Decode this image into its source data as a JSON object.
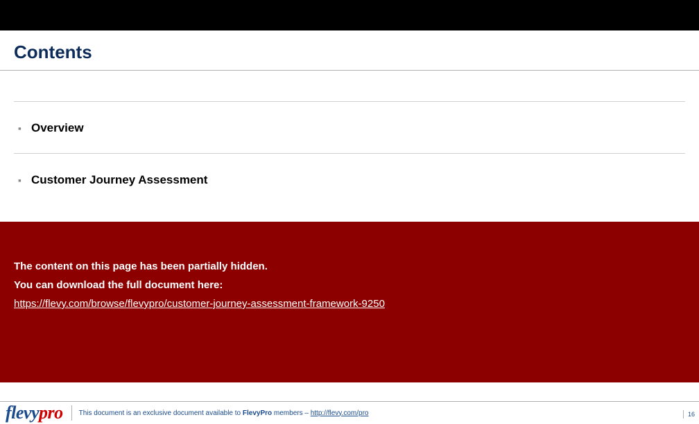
{
  "header": {
    "title": "Contents"
  },
  "toc": {
    "items": [
      {
        "label": "Overview"
      },
      {
        "label": "Customer Journey Assessment"
      }
    ]
  },
  "overlay": {
    "line1": "The content on this page has been partially hidden.",
    "line2": "You can download the full document here:",
    "link": "https://flevy.com/browse/flevypro/customer-journey-assessment-framework-9250"
  },
  "footer": {
    "logo_part1": "flevy",
    "logo_part2": "pro",
    "text_prefix": "This document is an exclusive document available to ",
    "text_bold": "FlevyPro",
    "text_mid": " members – ",
    "link_text": "http://flevy.com/pro",
    "page_number": "16"
  }
}
